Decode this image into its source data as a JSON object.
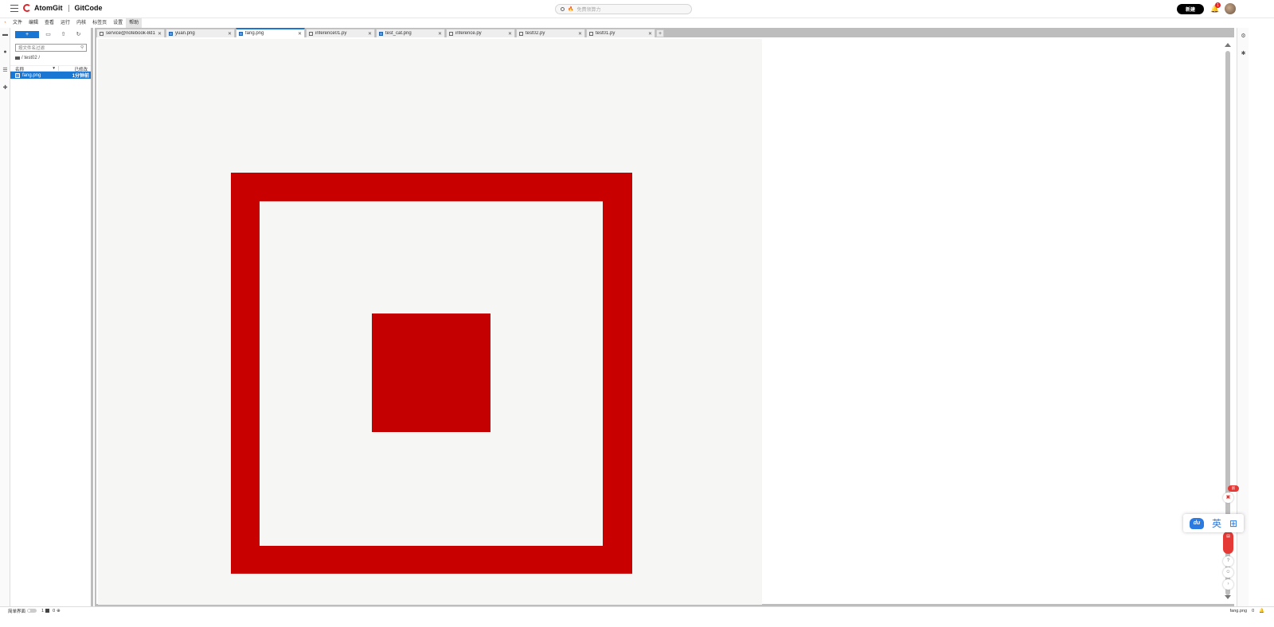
{
  "header": {
    "brand": "AtomGit",
    "product": "GitCode",
    "search_placeholder": "免费领算力",
    "new_button": "新建",
    "notification_count": "1"
  },
  "menubar": {
    "items": [
      "文件",
      "编辑",
      "查看",
      "运行",
      "内核",
      "标签页",
      "设置",
      "帮助"
    ]
  },
  "filebrowser": {
    "new_button": "+",
    "filter_placeholder": "按文件名过滤",
    "breadcrumb": "/ test02 /",
    "col_name": "名称",
    "col_modified": "已修改",
    "rows": [
      {
        "name": "fang.png",
        "modified": "1分钟前"
      }
    ]
  },
  "tabs": [
    {
      "label": "service@notebook-8d11a",
      "icon": "terminal-icon",
      "active": false
    },
    {
      "label": "yuan.png",
      "icon": "image-icon",
      "active": false
    },
    {
      "label": "fang.png",
      "icon": "image-icon",
      "active": true
    },
    {
      "label": "inference01.py",
      "icon": "file-icon",
      "active": false
    },
    {
      "label": "test_cat.png",
      "icon": "image-icon",
      "active": false
    },
    {
      "label": "inference.py",
      "icon": "file-icon",
      "active": false
    },
    {
      "label": "test02.py",
      "icon": "file-icon",
      "active": false
    },
    {
      "label": "test01.py",
      "icon": "file-icon",
      "active": false
    }
  ],
  "ime": {
    "english": "英"
  },
  "statusbar": {
    "simple_mode": "简单界面",
    "terminals": "1",
    "kernels": "0",
    "filename": "fang.png",
    "right_count": "0"
  },
  "colors": {
    "accent": "#1976d2",
    "brand_red": "#d8262d",
    "image_red": "#c80000"
  }
}
